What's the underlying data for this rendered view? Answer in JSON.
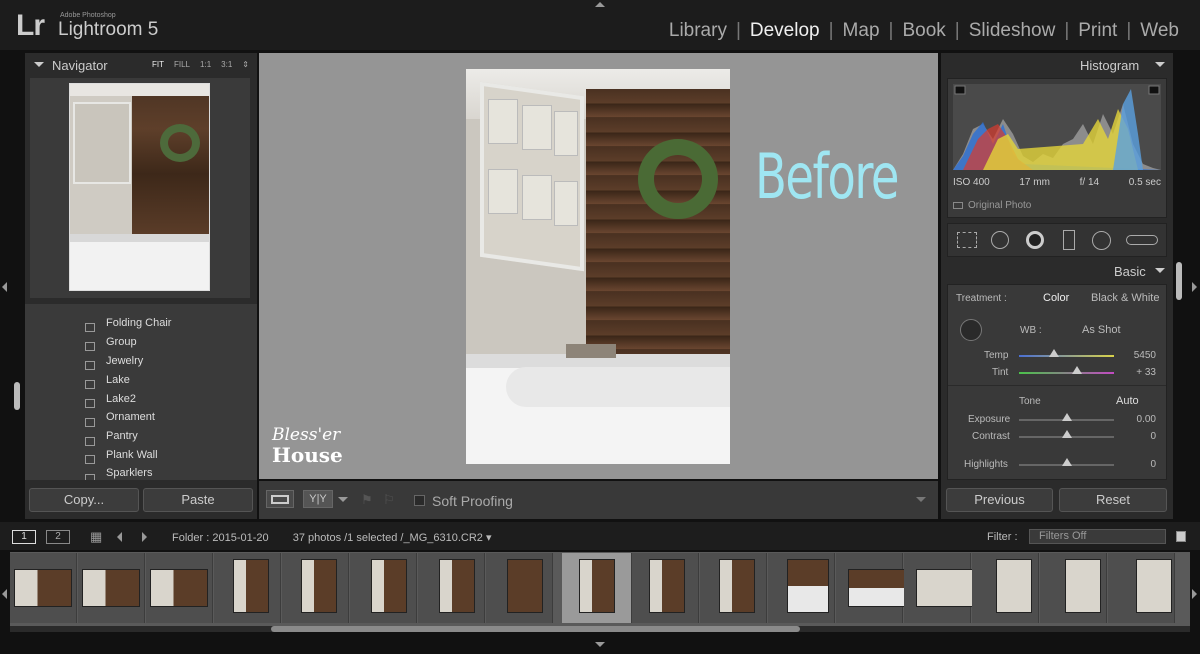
{
  "app": {
    "logo": "Lr",
    "subtitle": "Adobe Photoshop",
    "name": "Lightroom 5"
  },
  "modules": [
    {
      "label": "Library",
      "active": false
    },
    {
      "label": "Develop",
      "active": true
    },
    {
      "label": "Map",
      "active": false
    },
    {
      "label": "Book",
      "active": false
    },
    {
      "label": "Slideshow",
      "active": false
    },
    {
      "label": "Print",
      "active": false
    },
    {
      "label": "Web",
      "active": false
    }
  ],
  "navigator": {
    "title": "Navigator",
    "modes": [
      "FIT",
      "FILL",
      "1:1",
      "3:1"
    ]
  },
  "presets": [
    "Folding Chair",
    "Group",
    "Jewelry",
    "Lake",
    "Lake2",
    "Ornament",
    "Pantry",
    "Plank Wall",
    "Sparklers"
  ],
  "left_buttons": {
    "copy": "Copy...",
    "paste": "Paste"
  },
  "photo_overlay": {
    "before": "Before",
    "watermark_line1": "Bless'er",
    "watermark_line2": "House"
  },
  "toolbar": {
    "soft_proofing": "Soft Proofing",
    "view_modes": "Y|Y"
  },
  "histogram": {
    "title": "Histogram",
    "iso": "ISO 400",
    "focal": "17 mm",
    "aperture": "f/ 14",
    "shutter": "0.5 sec",
    "original_photo": "Original Photo"
  },
  "basic": {
    "title": "Basic",
    "treatment_label": "Treatment :",
    "color": "Color",
    "bw": "Black & White",
    "wb_label": "WB :",
    "wb_value": "As Shot",
    "temp_label": "Temp",
    "temp_value": "5450",
    "tint_label": "Tint",
    "tint_value": "+ 33",
    "tone_label": "Tone",
    "auto": "Auto",
    "exposure_label": "Exposure",
    "exposure_value": "0.00",
    "contrast_label": "Contrast",
    "contrast_value": "0",
    "highlights_label": "Highlights",
    "highlights_value": "0"
  },
  "right_buttons": {
    "previous": "Previous",
    "reset": "Reset"
  },
  "filmbar": {
    "page1": "1",
    "page2": "2",
    "folder": "Folder : 2015-01-20",
    "count": "37 photos /1 selected /_MG_6310.CR2",
    "filter_label": "Filter :",
    "filter_value": "Filters Off"
  },
  "colors": {
    "accent_before": "#9fe6f2",
    "panel_bg": "#2b2b2b",
    "center_bg": "#959595"
  }
}
